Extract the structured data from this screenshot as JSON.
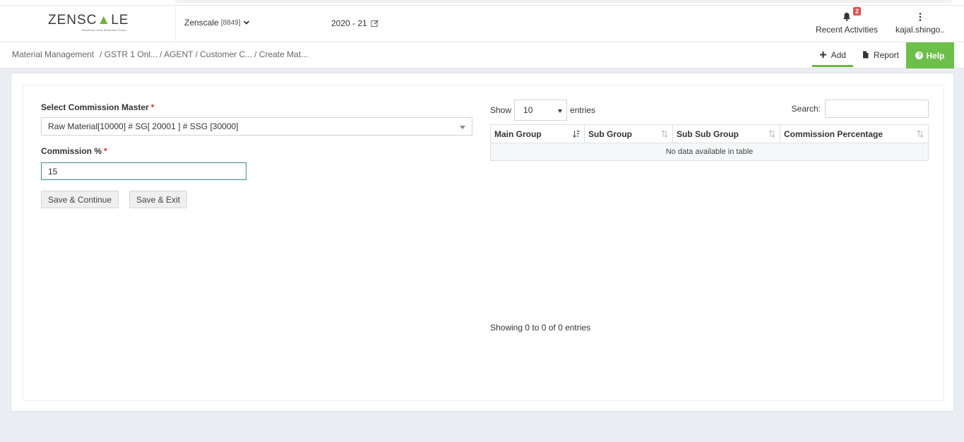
{
  "header": {
    "logo_text_a": "ZENSC",
    "logo_text_b": "LE",
    "logo_tagline": "Business Look. Business Focus.",
    "company_name": "Zenscale",
    "company_code": "[8849]",
    "fiscal_year": "2020 - 21",
    "notifications_count": "2",
    "recent_activities_label": "Recent Activities",
    "user_label": "kajal.shingo.."
  },
  "breadcrumb": {
    "items": [
      "Material Management",
      "/ GSTR 1 Onl...",
      "/ AGENT",
      "/ Customer C...",
      "/ Create Mat..."
    ]
  },
  "actions": {
    "add_label": "Add",
    "report_label": "Report",
    "help_label": "Help"
  },
  "form": {
    "master_label": "Select Commission Master",
    "master_value": "Raw Material[10000] # SG[ 20001 ] # SSG [30000]",
    "commission_label": "Commission %",
    "commission_value": "15",
    "required_mark": "*",
    "save_continue_label": "Save & Continue",
    "save_exit_label": "Save & Exit"
  },
  "table": {
    "show_label": "Show",
    "entries_label": "entries",
    "page_length": "10",
    "search_label": "Search:",
    "columns": [
      "Main Group",
      "Sub Group",
      "Sub Sub Group",
      "Commission Percentage"
    ],
    "empty_message": "No data available in table",
    "info": "Showing 0 to 0 of 0 entries"
  },
  "colors": {
    "accent_green": "#6cc04a",
    "required_red": "#d9302c",
    "badge_red": "#d9534f"
  }
}
